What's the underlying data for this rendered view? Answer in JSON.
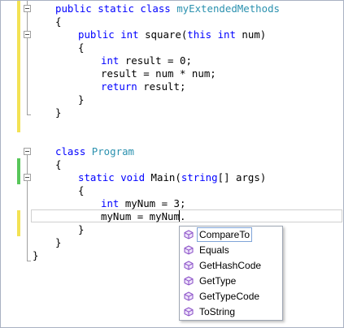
{
  "editor": {
    "colors": {
      "keyword": "#0000ff",
      "type": "#2b91af",
      "text": "#000000",
      "changed_saved": "#59c75b",
      "changed_unsaved": "#f3e254",
      "icon": "#8a4fc7"
    },
    "lines": [
      {
        "segments": [
          {
            "t": "public static class ",
            "c": "kw"
          },
          {
            "t": "myExtendedMethods",
            "c": "ty"
          }
        ]
      },
      {
        "segments": [
          {
            "t": "{",
            "c": ""
          }
        ]
      },
      {
        "segments": [
          {
            "t": "public int ",
            "c": "kw"
          },
          {
            "t": "square(",
            "c": ""
          },
          {
            "t": "this int ",
            "c": "kw"
          },
          {
            "t": "num)",
            "c": ""
          }
        ]
      },
      {
        "segments": [
          {
            "t": "{",
            "c": ""
          }
        ]
      },
      {
        "segments": [
          {
            "t": "int ",
            "c": "kw"
          },
          {
            "t": "result = 0;",
            "c": ""
          }
        ]
      },
      {
        "segments": [
          {
            "t": "result = num * num;",
            "c": ""
          }
        ]
      },
      {
        "segments": [
          {
            "t": "return ",
            "c": "kw"
          },
          {
            "t": "result;",
            "c": ""
          }
        ]
      },
      {
        "segments": [
          {
            "t": "}",
            "c": ""
          }
        ]
      },
      {
        "segments": [
          {
            "t": "}",
            "c": ""
          }
        ]
      },
      {
        "segments": [
          {
            "t": "class ",
            "c": "kw"
          },
          {
            "t": "Program",
            "c": "ty"
          }
        ]
      },
      {
        "segments": [
          {
            "t": "{",
            "c": ""
          }
        ]
      },
      {
        "segments": [
          {
            "t": "static void ",
            "c": "kw"
          },
          {
            "t": "Main(",
            "c": ""
          },
          {
            "t": "string",
            "c": "kw"
          },
          {
            "t": "[] args)",
            "c": ""
          }
        ]
      },
      {
        "segments": [
          {
            "t": "{",
            "c": ""
          }
        ]
      },
      {
        "segments": [
          {
            "t": "int ",
            "c": "kw"
          },
          {
            "t": "myNum = 3;",
            "c": ""
          }
        ]
      },
      {
        "segments": [
          {
            "t": "myNum = myNum.",
            "c": ""
          }
        ]
      },
      {
        "segments": [
          {
            "t": "}",
            "c": ""
          }
        ]
      },
      {
        "segments": [
          {
            "t": "}",
            "c": ""
          }
        ]
      },
      {
        "segments": [
          {
            "t": "}",
            "c": ""
          }
        ]
      }
    ]
  },
  "completion": {
    "icon": "method-icon",
    "items": [
      "CompareTo",
      "Equals",
      "GetHashCode",
      "GetType",
      "GetTypeCode",
      "ToString"
    ],
    "selected_index": 0
  }
}
